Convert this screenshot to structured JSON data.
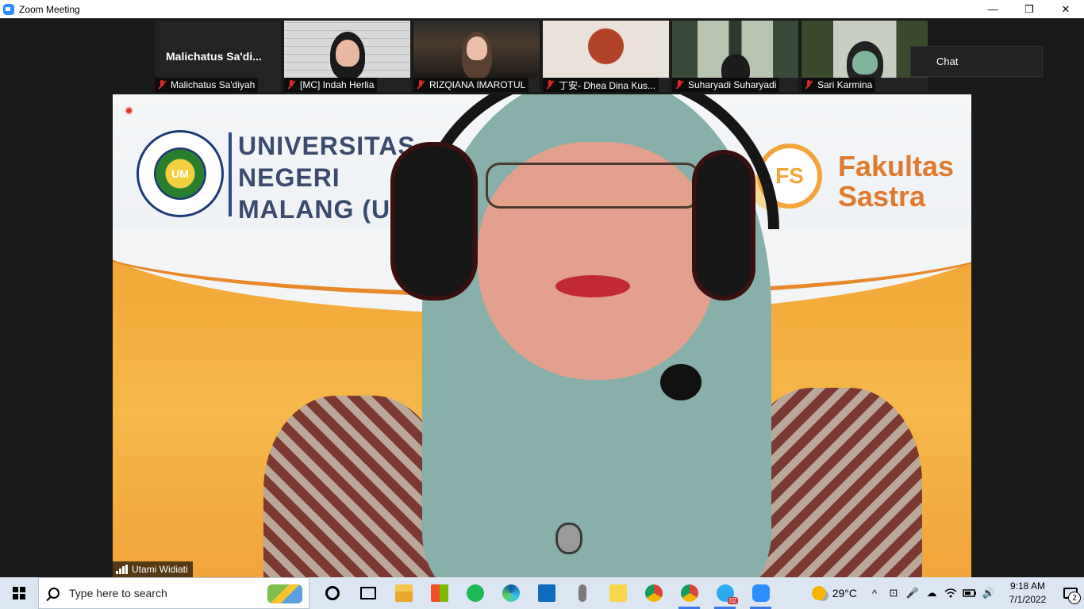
{
  "window": {
    "title": "Zoom Meeting",
    "minimize": "—",
    "restore": "❐",
    "close": "✕"
  },
  "participants": [
    {
      "display_name": "Malichatus Sa'di...",
      "label": "Malichatus Sa'diyah",
      "video": false
    },
    {
      "label": "[MC] Indah Herlia",
      "video": true
    },
    {
      "label": "RIZQIANA IMAROTUL",
      "video": true
    },
    {
      "label": "丁安- Dhea Dina Kus...",
      "video": true
    },
    {
      "label": "Suharyadi Suharyadi",
      "video": true
    },
    {
      "label": "Sari Karmina",
      "video": true
    }
  ],
  "chat_popup": {
    "label": "Chat"
  },
  "main_video": {
    "speaker_name": "Utami Widiati",
    "background_text_left": [
      "UNIVERSITAS",
      "NEGERI",
      "MALANG (U"
    ],
    "logo_left_text": "UM",
    "logo_right_text": "FS",
    "background_text_right": [
      "Fakultas",
      "Sastra"
    ]
  },
  "taskbar": {
    "search_placeholder": "Type here to search",
    "telegram_badge": "02",
    "weather": "29°C",
    "tray_icons": [
      "^",
      "⊡",
      "🎤",
      "☁",
      "wifi",
      "battery",
      "🔊"
    ],
    "time": "9:18 AM",
    "date": "7/1/2022",
    "notification_count": "2"
  }
}
